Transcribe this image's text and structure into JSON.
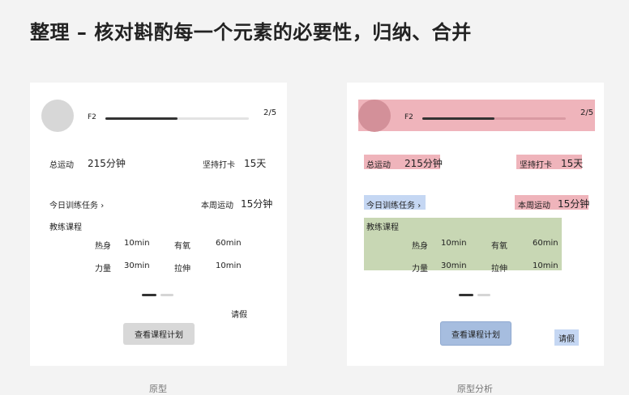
{
  "title": "整理 – 核对斟酌每一个元素的必要性，归纳、合并",
  "captions": {
    "prototype": "原型",
    "analysis": "原型分析"
  },
  "card": {
    "level": "F2",
    "page": "2/5",
    "progress": 0.5,
    "total_label": "总运动",
    "total_value": "215分钟",
    "checkin_label": "坚持打卡",
    "checkin_value": "15天",
    "today_task": "今日训练任务",
    "week_label": "本周运动",
    "week_value": "15分钟",
    "course_title": "教练课程",
    "courses": [
      {
        "name": "热身",
        "time": "10min"
      },
      {
        "name": "有氧",
        "time": "60min"
      },
      {
        "name": "力量",
        "time": "30min"
      },
      {
        "name": "拉伸",
        "time": "10min"
      }
    ],
    "leave": "请假",
    "view_button": "查看课程计划"
  },
  "colors": {
    "highlight_red": "#efb4bb",
    "highlight_blue": "#c5d7f3",
    "highlight_green": "#c8d7b4"
  }
}
